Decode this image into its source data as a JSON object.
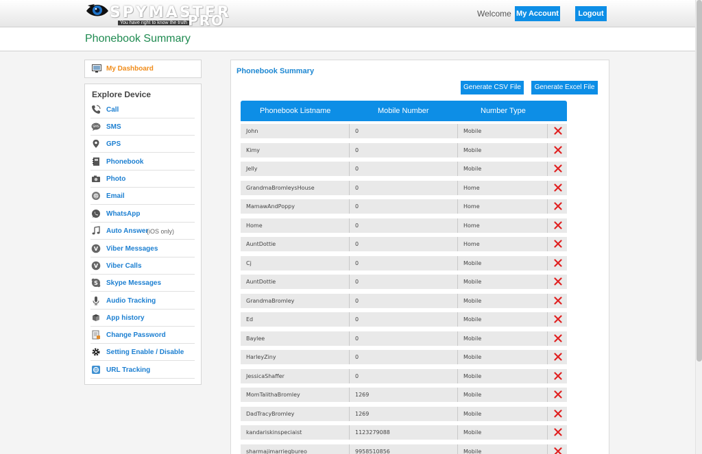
{
  "header": {
    "logo_text": "SPYMASTER",
    "logo_pro": "PRO",
    "logo_tagline": "You have right to know the truth",
    "welcome": "Welcome",
    "my_account": "My Account",
    "logout": "Logout"
  },
  "page_title": "Phonebook Summary",
  "sidebar": {
    "dashboard": "My Dashboard",
    "explore_title": "Explore Device",
    "items": [
      {
        "label": "Call",
        "icon": "phone-icon"
      },
      {
        "label": "SMS",
        "icon": "sms-bubble-icon"
      },
      {
        "label": "GPS",
        "icon": "map-pin-icon"
      },
      {
        "label": "Phonebook",
        "icon": "phonebook-icon"
      },
      {
        "label": "Photo",
        "icon": "camera-icon"
      },
      {
        "label": "Email",
        "icon": "email-icon"
      },
      {
        "label": "WhatsApp",
        "icon": "whatsapp-icon"
      },
      {
        "label": "Auto Answer",
        "sub": "(iOS only)",
        "icon": "music-note-icon"
      },
      {
        "label": "Viber Messages",
        "icon": "viber-icon"
      },
      {
        "label": "Viber Calls",
        "icon": "viber-icon"
      },
      {
        "label": "Skype Messages",
        "icon": "skype-icon"
      },
      {
        "label": "Audio Tracking",
        "icon": "microphone-icon"
      },
      {
        "label": "App history",
        "icon": "app-history-icon"
      },
      {
        "label": "Change Password",
        "icon": "password-icon"
      },
      {
        "label": "Setting Enable / Disable",
        "icon": "gear-icon"
      },
      {
        "label": "URL Tracking",
        "icon": "url-icon"
      }
    ]
  },
  "main": {
    "title": "Phonebook Summary",
    "csv_button": "Generate CSV File",
    "excel_button": "Generate Excel File",
    "columns": [
      "Phonebook Listname",
      "Mobile Number",
      "Number Type"
    ],
    "rows": [
      {
        "name": "John",
        "number": "0",
        "type": "Mobile"
      },
      {
        "name": "Kimy",
        "number": "0",
        "type": "Mobile"
      },
      {
        "name": "Jelly",
        "number": "0",
        "type": "Mobile"
      },
      {
        "name": "GrandmaBromleysHouse",
        "number": "0",
        "type": "Home"
      },
      {
        "name": "MamawAndPoppy",
        "number": "0",
        "type": "Home"
      },
      {
        "name": "Home",
        "number": "0",
        "type": "Home"
      },
      {
        "name": "AuntDottie",
        "number": "0",
        "type": "Home"
      },
      {
        "name": "Cj",
        "number": "0",
        "type": "Mobile"
      },
      {
        "name": "AuntDottie",
        "number": "0",
        "type": "Mobile"
      },
      {
        "name": "GrandmaBromley",
        "number": "0",
        "type": "Mobile"
      },
      {
        "name": "Ed",
        "number": "0",
        "type": "Mobile"
      },
      {
        "name": "Baylee",
        "number": "0",
        "type": "Mobile"
      },
      {
        "name": "HarleyZiny",
        "number": "0",
        "type": "Mobile"
      },
      {
        "name": "JessicaShaffer",
        "number": "0",
        "type": "Mobile"
      },
      {
        "name": "MomTalithaBromley",
        "number": "1269",
        "type": "Mobile"
      },
      {
        "name": "DadTracyBromley",
        "number": "1269",
        "type": "Mobile"
      },
      {
        "name": "kandariskinspeciaist",
        "number": "1123279088",
        "type": "Mobile"
      },
      {
        "name": "sharmajimarriegbureo",
        "number": "9958510856",
        "type": "Mobile"
      }
    ]
  },
  "colors": {
    "accent_blue": "#0d8ee6",
    "title_green": "#1e8a50",
    "dashboard_orange": "#f08c1a",
    "delete_red": "#e02020"
  }
}
